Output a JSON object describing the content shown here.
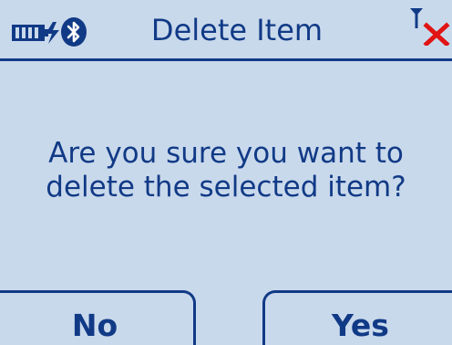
{
  "header": {
    "title": "Delete Item",
    "icons": [
      "battery-icon",
      "bluetooth-icon",
      "no-signal-icon"
    ]
  },
  "dialog": {
    "line1": "Are you sure you want to",
    "line2": "delete the selected item?"
  },
  "softkeys": {
    "left_label": "No",
    "right_label": "Yes"
  },
  "colors": {
    "background": "#c9d9ec",
    "text": "#113a86",
    "error_x": "#e11414"
  }
}
